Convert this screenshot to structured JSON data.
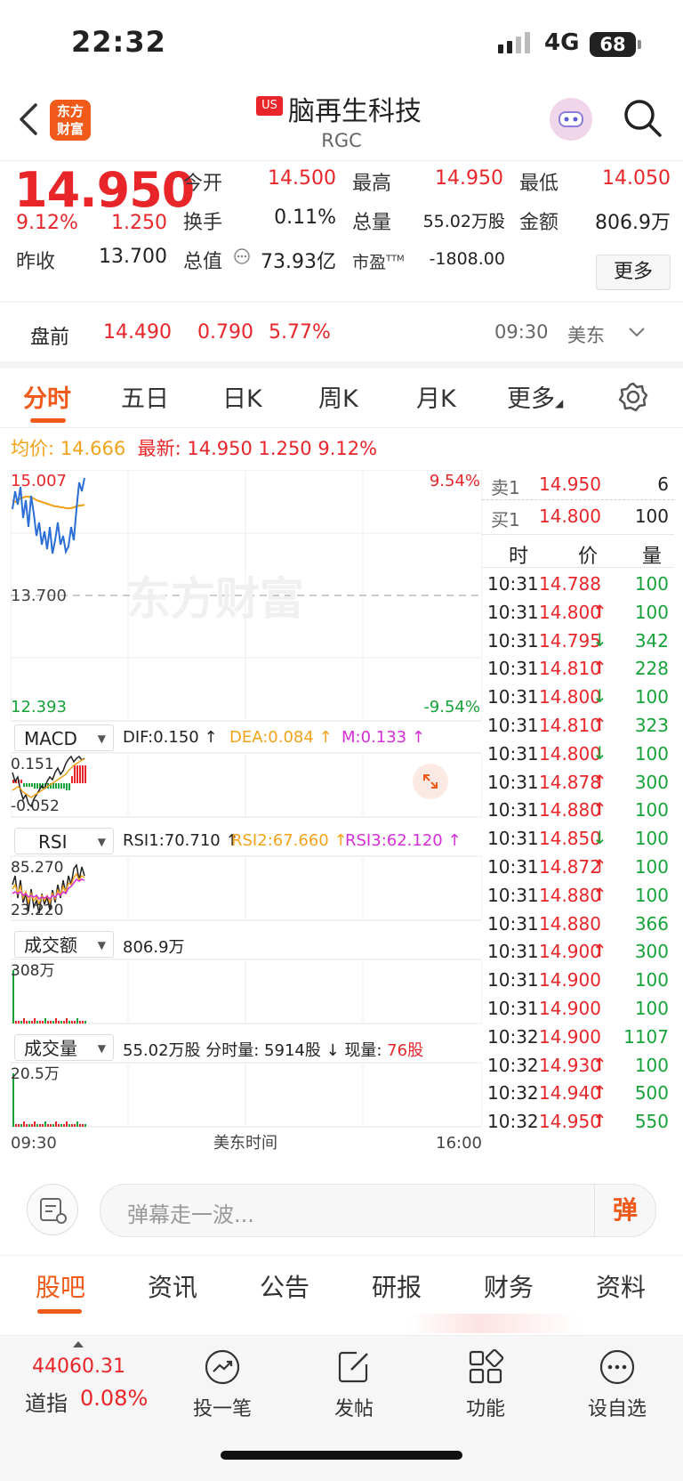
{
  "status_bar": {
    "time": "22:32",
    "network": "4G",
    "battery": "68"
  },
  "header": {
    "logo_line1": "东方",
    "logo_line2": "财富",
    "market_badge": "US",
    "stock_name": "脑再生科技",
    "ticker": "RGC"
  },
  "quote": {
    "price": "14.950",
    "change_pct": "9.12%",
    "change": "1.250",
    "prev_close_label": "昨收",
    "prev_close": "13.700",
    "open_label": "今开",
    "open": "14.500",
    "turnover_label": "换手",
    "turnover": "0.11%",
    "mktcap_label": "总值",
    "mktcap": "73.93亿",
    "high_label": "最高",
    "high": "14.950",
    "volume_label": "总量",
    "volume": "55.02万股",
    "pe_label": "市盈",
    "pe_sup": "TTM",
    "pe": "-1808.00",
    "low_label": "最低",
    "low": "14.050",
    "amount_label": "金额",
    "amount": "806.9万",
    "more_label": "更多"
  },
  "premarket": {
    "label": "盘前",
    "price": "14.490",
    "change": "0.790",
    "pct": "5.77%",
    "time": "09:30",
    "zone": "美东"
  },
  "tabs": [
    "分时",
    "五日",
    "日K",
    "周K",
    "月K",
    "更多"
  ],
  "chart_info": {
    "avg_label": "均价:",
    "avg": "14.666",
    "latest_label": "最新:",
    "latest": "14.950",
    "change": "1.250",
    "pct": "9.12%"
  },
  "chart": {
    "y_top": "15.007",
    "y_mid": "13.700",
    "y_bottom": "12.393",
    "pct_top": "9.54%",
    "pct_bottom": "-9.54%",
    "watermark": "东方财富",
    "x_start": "09:30",
    "x_mid": "美东时间",
    "x_end": "16:00"
  },
  "macd": {
    "name": "MACD",
    "dif": "DIF:0.150 ↑",
    "dea": "DEA:0.084 ↑",
    "m": "M:0.133 ↑",
    "top": "0.151",
    "bottom": "-0.052"
  },
  "rsi": {
    "name": "RSI",
    "rsi1": "RSI1:70.710 ↑",
    "rsi2": "RSI2:67.660 ↑",
    "rsi3": "RSI3:62.120 ↑",
    "top": "85.270",
    "bottom": "23.220"
  },
  "amount_panel": {
    "name": "成交额",
    "value": "806.9万",
    "top": "308万"
  },
  "volume_panel": {
    "name": "成交量",
    "value": "55.02万股 分时量: 5914股 ↓ 现量:",
    "now": "76股",
    "top": "20.5万"
  },
  "order_book": {
    "ask_label": "卖1",
    "ask_price": "14.950",
    "ask_qty": "6",
    "bid_label": "买1",
    "bid_price": "14.800",
    "bid_qty": "100",
    "headers": [
      "时",
      "价",
      "量"
    ],
    "trades": [
      {
        "t": "10:31",
        "p": "14.788",
        "d": "",
        "q": "100"
      },
      {
        "t": "10:31",
        "p": "14.800",
        "d": "↑",
        "q": "100"
      },
      {
        "t": "10:31",
        "p": "14.795",
        "d": "↓",
        "q": "342"
      },
      {
        "t": "10:31",
        "p": "14.810",
        "d": "↑",
        "q": "228"
      },
      {
        "t": "10:31",
        "p": "14.800",
        "d": "↓",
        "q": "100"
      },
      {
        "t": "10:31",
        "p": "14.810",
        "d": "↑",
        "q": "323"
      },
      {
        "t": "10:31",
        "p": "14.800",
        "d": "↓",
        "q": "100"
      },
      {
        "t": "10:31",
        "p": "14.878",
        "d": "↑",
        "q": "300"
      },
      {
        "t": "10:31",
        "p": "14.880",
        "d": "↑",
        "q": "100"
      },
      {
        "t": "10:31",
        "p": "14.850",
        "d": "↓",
        "q": "100"
      },
      {
        "t": "10:31",
        "p": "14.872",
        "d": "↑",
        "q": "100"
      },
      {
        "t": "10:31",
        "p": "14.880",
        "d": "↑",
        "q": "100"
      },
      {
        "t": "10:31",
        "p": "14.880",
        "d": "",
        "q": "366"
      },
      {
        "t": "10:31",
        "p": "14.900",
        "d": "↑",
        "q": "300"
      },
      {
        "t": "10:31",
        "p": "14.900",
        "d": "",
        "q": "100"
      },
      {
        "t": "10:31",
        "p": "14.900",
        "d": "",
        "q": "100"
      },
      {
        "t": "10:32",
        "p": "14.900",
        "d": "",
        "q": "1107"
      },
      {
        "t": "10:32",
        "p": "14.930",
        "d": "↑",
        "q": "100"
      },
      {
        "t": "10:32",
        "p": "14.940",
        "d": "↑",
        "q": "500"
      },
      {
        "t": "10:32",
        "p": "14.950",
        "d": "↑",
        "q": "550"
      }
    ]
  },
  "comment": {
    "placeholder": "弹幕走一波...",
    "button": "弹"
  },
  "bottom_tabs": [
    "股吧",
    "资讯",
    "公告",
    "研报",
    "财务",
    "资料"
  ],
  "toolbar": {
    "index_value": "44060.31",
    "index_name": "道指",
    "index_pct": "0.08%",
    "tools": [
      "投一笔",
      "发帖",
      "功能",
      "设自选"
    ]
  },
  "colors": {
    "up": "#e8262a",
    "down": "#17a33a",
    "accent": "#f05a1a",
    "avg_line": "#f2a31b"
  }
}
